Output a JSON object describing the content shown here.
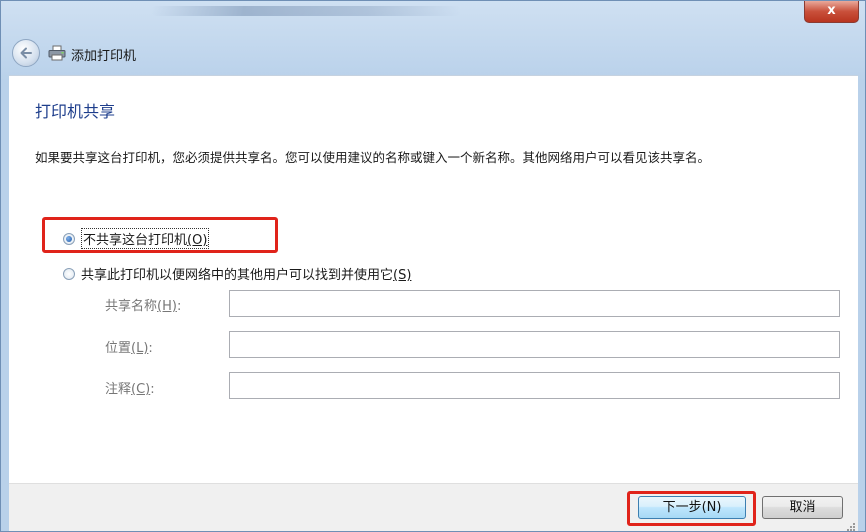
{
  "window": {
    "close_symbol": "x"
  },
  "nav": {
    "title": "添加打印机",
    "back_icon": "back-arrow-icon",
    "printer_icon": "printer-icon"
  },
  "page": {
    "heading": "打印机共享",
    "description": "如果要共享这台打印机，您必须提供共享名。您可以使用建议的名称或键入一个新名称。其他网络用户可以看见该共享名。"
  },
  "options": {
    "no_share": {
      "label": "不共享这台打印机",
      "mnemonic": "(O)",
      "checked": true
    },
    "share": {
      "label": "共享此打印机以便网络中的其他用户可以找到并使用它",
      "mnemonic": "(S)",
      "checked": false
    }
  },
  "fields": {
    "share_name": {
      "label": "共享名称",
      "mnemonic": "(H)",
      "suffix": ":",
      "value": ""
    },
    "location": {
      "label": "位置",
      "mnemonic": "(L)",
      "suffix": ":",
      "value": ""
    },
    "comment": {
      "label": "注释",
      "mnemonic": "(C)",
      "suffix": ":",
      "value": ""
    }
  },
  "buttons": {
    "next": "下一步(N)",
    "cancel": "取消"
  },
  "colors": {
    "heading": "#1e3e8c",
    "highlight": "#e0231a",
    "window_frame": "#b9d1ea"
  }
}
